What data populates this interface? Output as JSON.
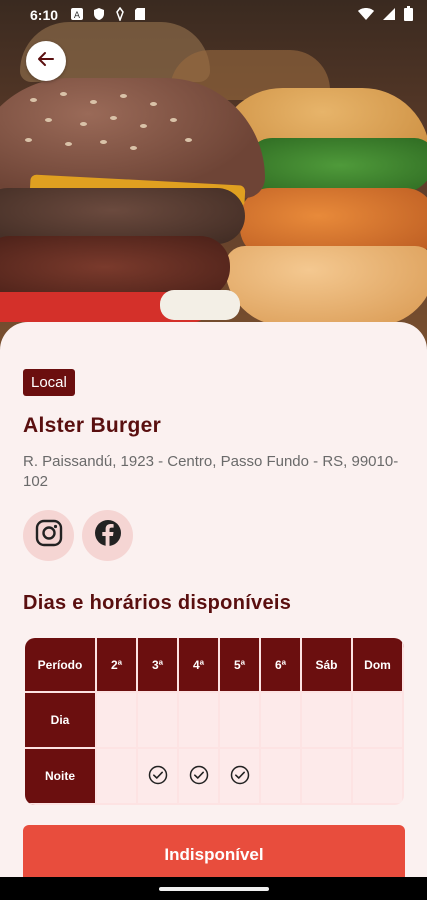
{
  "status_bar": {
    "time": "6:10"
  },
  "place": {
    "tag": "Local",
    "name": "Alster Burger",
    "address": "R. Paissandú, 1923 - Centro, Passo Fundo - RS, 99010-102"
  },
  "social": [
    {
      "icon": "instagram-icon"
    },
    {
      "icon": "facebook-icon"
    }
  ],
  "schedule": {
    "title": "Dias e horários disponíveis",
    "headers": [
      "Período",
      "2ª",
      "3ª",
      "4ª",
      "5ª",
      "6ª",
      "Sáb",
      "Dom"
    ],
    "rows": [
      {
        "label": "Dia",
        "checks": [
          false,
          false,
          false,
          false,
          false,
          false,
          false
        ]
      },
      {
        "label": "Noite",
        "checks": [
          false,
          true,
          true,
          true,
          false,
          false,
          false
        ]
      }
    ]
  },
  "action_button": {
    "label": "Indisponível"
  },
  "colors": {
    "primary": "#6b0f0f",
    "accent": "#e84d3d",
    "sheet": "#fbf1f0"
  }
}
